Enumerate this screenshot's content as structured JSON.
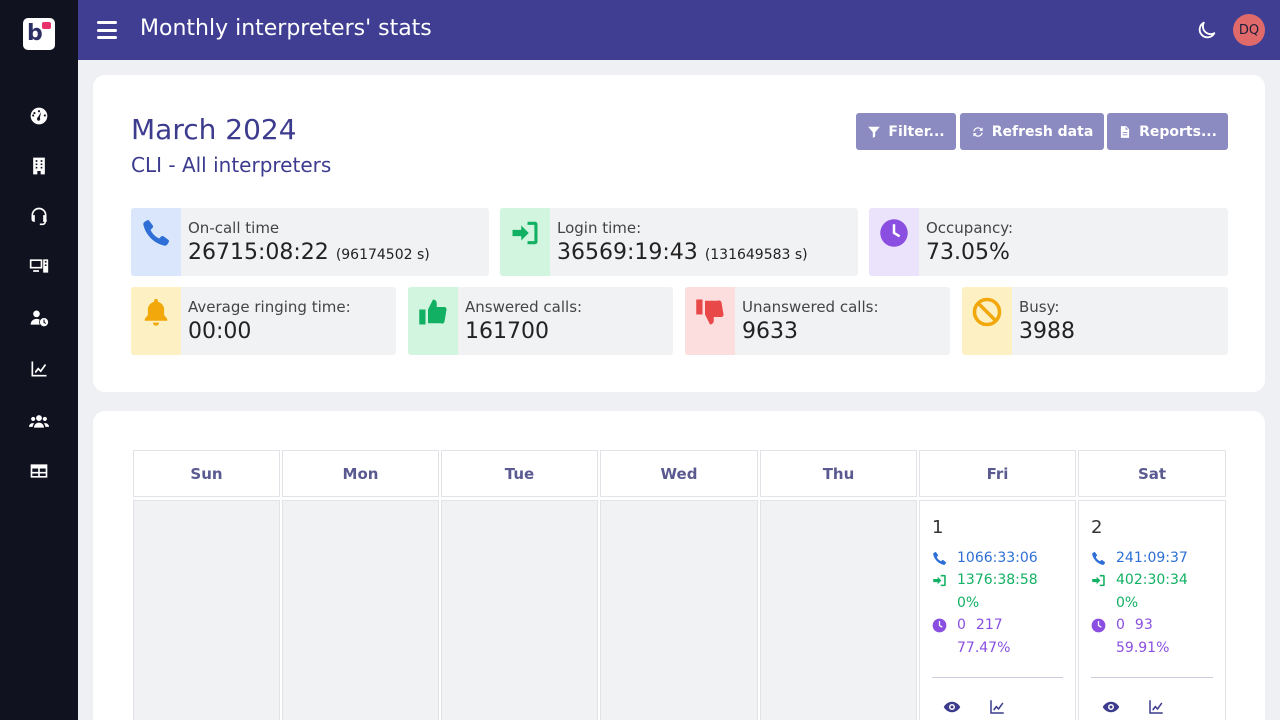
{
  "header": {
    "title": "Monthly interpreters' stats",
    "avatar_initials": "DQ"
  },
  "sidebar": {
    "items": [
      {
        "icon": "gauge-icon"
      },
      {
        "icon": "building-icon"
      },
      {
        "icon": "headset-icon"
      },
      {
        "icon": "computer-icon"
      },
      {
        "icon": "user-clock-icon"
      },
      {
        "icon": "line-chart-icon"
      },
      {
        "icon": "users-icon"
      },
      {
        "icon": "table-icon"
      }
    ]
  },
  "summary": {
    "month": "March 2024",
    "subtitle": "CLI - All interpreters",
    "buttons": {
      "filter": "Filter...",
      "refresh": "Refresh data",
      "reports": "Reports..."
    },
    "stats": {
      "oncall": {
        "label": "On-call time",
        "value": "26715:08:22",
        "secondary": "(96174502 s)"
      },
      "login": {
        "label": "Login time:",
        "value": "36569:19:43",
        "secondary": "(131649583 s)"
      },
      "occupancy": {
        "label": "Occupancy:",
        "value": "73.05%"
      },
      "ringing": {
        "label": "Average ringing time:",
        "value": "00:00"
      },
      "answered": {
        "label": "Answered calls:",
        "value": "161700"
      },
      "unanswered": {
        "label": "Unanswered calls:",
        "value": "9633"
      },
      "busy": {
        "label": "Busy:",
        "value": "3988"
      }
    }
  },
  "calendar": {
    "weekdays": [
      "Sun",
      "Mon",
      "Tue",
      "Wed",
      "Thu",
      "Fri",
      "Sat"
    ],
    "days": [
      {
        "day": "1",
        "oncall": "1066:33:06",
        "login": "1376:38:58",
        "login_pct": "0%",
        "occ_a": "0",
        "occ_b": "217",
        "occ_pct": "77.47%"
      },
      {
        "day": "2",
        "oncall": "241:09:37",
        "login": "402:30:34",
        "login_pct": "0%",
        "occ_a": "0",
        "occ_b": "93",
        "occ_pct": "59.91%"
      }
    ]
  },
  "colors": {
    "topbar": "#403e92",
    "sidebar": "#11121f",
    "accent": "#3d3b8e",
    "button": "#8b8bc2",
    "oncall": "#2d6fd6",
    "login": "#12b063",
    "occupancy": "#8a4fe0"
  }
}
